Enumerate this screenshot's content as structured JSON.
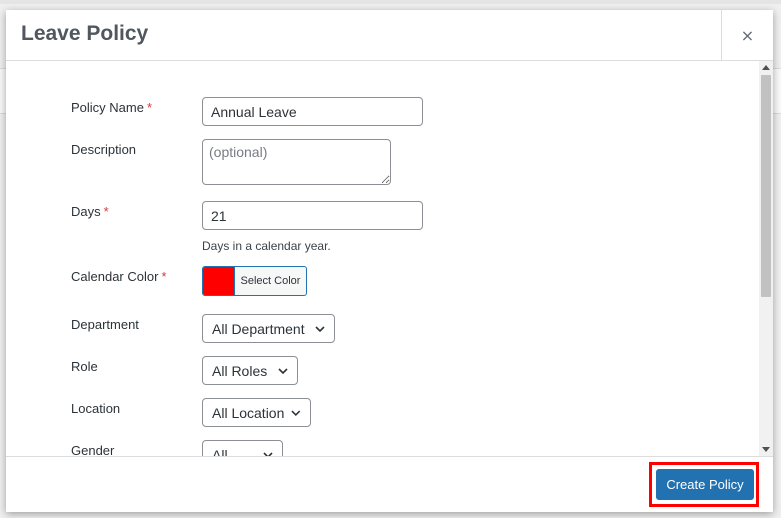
{
  "modal": {
    "title": "Leave Policy",
    "close_label": "×"
  },
  "form": {
    "policy_name": {
      "label": "Policy Name",
      "required": "*",
      "value": "Annual Leave"
    },
    "description": {
      "label": "Description",
      "placeholder": "(optional)",
      "value": ""
    },
    "days": {
      "label": "Days",
      "required": "*",
      "value": "21",
      "hint": "Days in a calendar year."
    },
    "calendar_color": {
      "label": "Calendar Color",
      "required": "*",
      "button_label": "Select Color",
      "color": "#ff0000"
    },
    "department": {
      "label": "Department",
      "selected": "All Department"
    },
    "role": {
      "label": "Role",
      "selected": "All Roles"
    },
    "location": {
      "label": "Location",
      "selected": "All Location"
    },
    "gender": {
      "label": "Gender",
      "selected": "All"
    }
  },
  "footer": {
    "create_label": "Create Policy"
  },
  "colors": {
    "primary": "#2271b1",
    "required": "#d63638",
    "highlight": "#ff0000"
  }
}
